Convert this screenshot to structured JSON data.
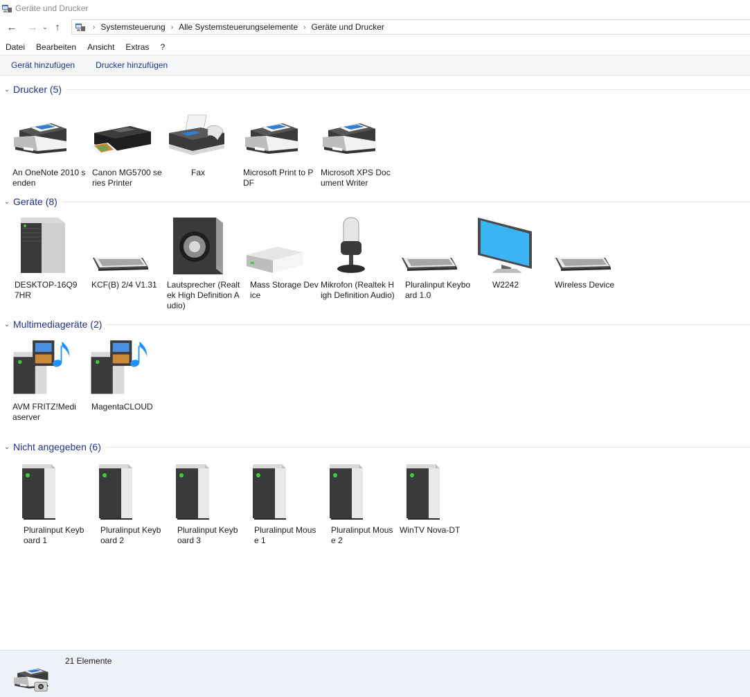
{
  "window": {
    "title": "Geräte und Drucker"
  },
  "address": {
    "crumbs": [
      "Systemsteuerung",
      "Alle Systemsteuerungselemente",
      "Geräte und Drucker"
    ]
  },
  "menu": [
    "Datei",
    "Bearbeiten",
    "Ansicht",
    "Extras",
    "?"
  ],
  "toolbar": {
    "add_device": "Gerät hinzufügen",
    "add_printer": "Drucker hinzufügen"
  },
  "groups": {
    "printers": {
      "title": "Drucker (5)",
      "items": [
        {
          "label": "An OneNote 2010 senden",
          "icon": "printer-icon"
        },
        {
          "label": "Canon MG5700 series Printer",
          "icon": "inkjet-printer-icon"
        },
        {
          "label": "Fax",
          "icon": "fax-icon"
        },
        {
          "label": "Microsoft Print to PDF",
          "icon": "printer-icon"
        },
        {
          "label": "Microsoft XPS Document Writer",
          "icon": "printer-icon"
        }
      ]
    },
    "devices": {
      "title": "Geräte (8)",
      "items": [
        {
          "label": "DESKTOP-16Q97HR",
          "icon": "computer-tower-icon"
        },
        {
          "label": "KCF(B) 2/4 V1.31",
          "icon": "keyboard-icon"
        },
        {
          "label": "Lautsprecher (Realtek High Definition Audio)",
          "icon": "speaker-icon"
        },
        {
          "label": "Mass Storage Device",
          "icon": "drive-icon"
        },
        {
          "label": "Mikrofon (Realtek High Definition Audio)",
          "icon": "microphone-icon"
        },
        {
          "label": "Pluralinput Keyboard 1.0",
          "icon": "keyboard-icon"
        },
        {
          "label": "W2242",
          "icon": "monitor-icon"
        },
        {
          "label": "Wireless Device",
          "icon": "keyboard-icon"
        }
      ]
    },
    "multimedia": {
      "title": "Multimediageräte (2)",
      "items": [
        {
          "label": "AVM FRITZ!Mediaserver",
          "icon": "media-server-icon"
        },
        {
          "label": "MagentaCLOUD",
          "icon": "media-server-icon"
        }
      ]
    },
    "unspecified": {
      "title": "Nicht angegeben (6)",
      "items": [
        {
          "label": "Pluralinput Keyboard 1",
          "icon": "generic-device-icon"
        },
        {
          "label": "Pluralinput Keyboard 2",
          "icon": "generic-device-icon"
        },
        {
          "label": "Pluralinput Keyboard 3",
          "icon": "generic-device-icon"
        },
        {
          "label": "Pluralinput Mouse 1",
          "icon": "generic-device-icon"
        },
        {
          "label": "Pluralinput Mouse 2",
          "icon": "generic-device-icon"
        },
        {
          "label": "WinTV Nova-DT",
          "icon": "generic-device-icon"
        }
      ]
    }
  },
  "status": {
    "count_text": "21 Elemente"
  },
  "colors": {
    "link_blue": "#1e3287",
    "toolbar_bg": "#f5f6f7",
    "status_bg": "#eef1f8"
  }
}
